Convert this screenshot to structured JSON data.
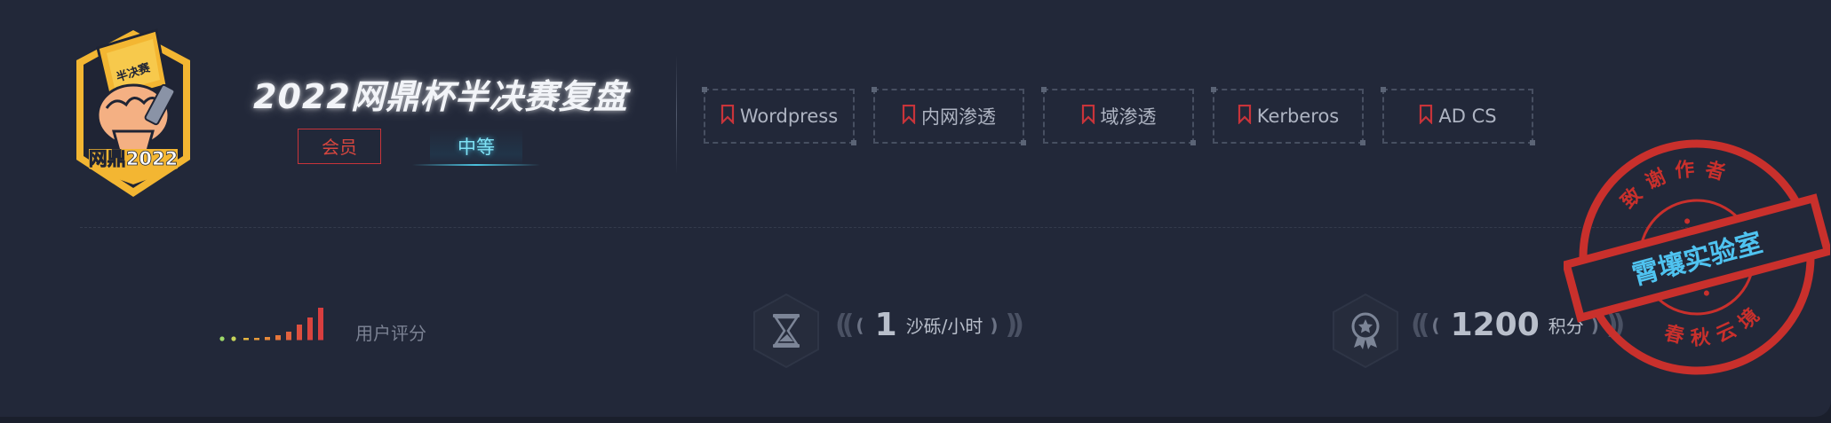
{
  "badge": {
    "top_text": "半决赛",
    "bottom_text": "网鼎2022"
  },
  "title": "2022网鼎杯半决赛复盘",
  "tags": {
    "member": "会员",
    "level": "中等"
  },
  "topics": [
    "Wordpress",
    "内网渗透",
    "域渗透",
    "Kerberos",
    "AD CS"
  ],
  "rating": {
    "label": "用户评分"
  },
  "sand": {
    "value": "1",
    "unit": "沙砾/小时"
  },
  "points": {
    "value": "1200",
    "unit": "积分"
  },
  "stamp": {
    "center": "霄壤实验室",
    "top": "致谢作者",
    "bottom": "春秋云境"
  },
  "colors": {
    "background": "#222839",
    "accent_red": "#d5463f",
    "accent_cyan": "#7fe2f5",
    "stamp_red": "#c9302c",
    "badge_gold": "#f3b632"
  },
  "icons": {
    "topic": "bookmark-icon",
    "sand": "hourglass-icon",
    "points": "medal-icon"
  }
}
